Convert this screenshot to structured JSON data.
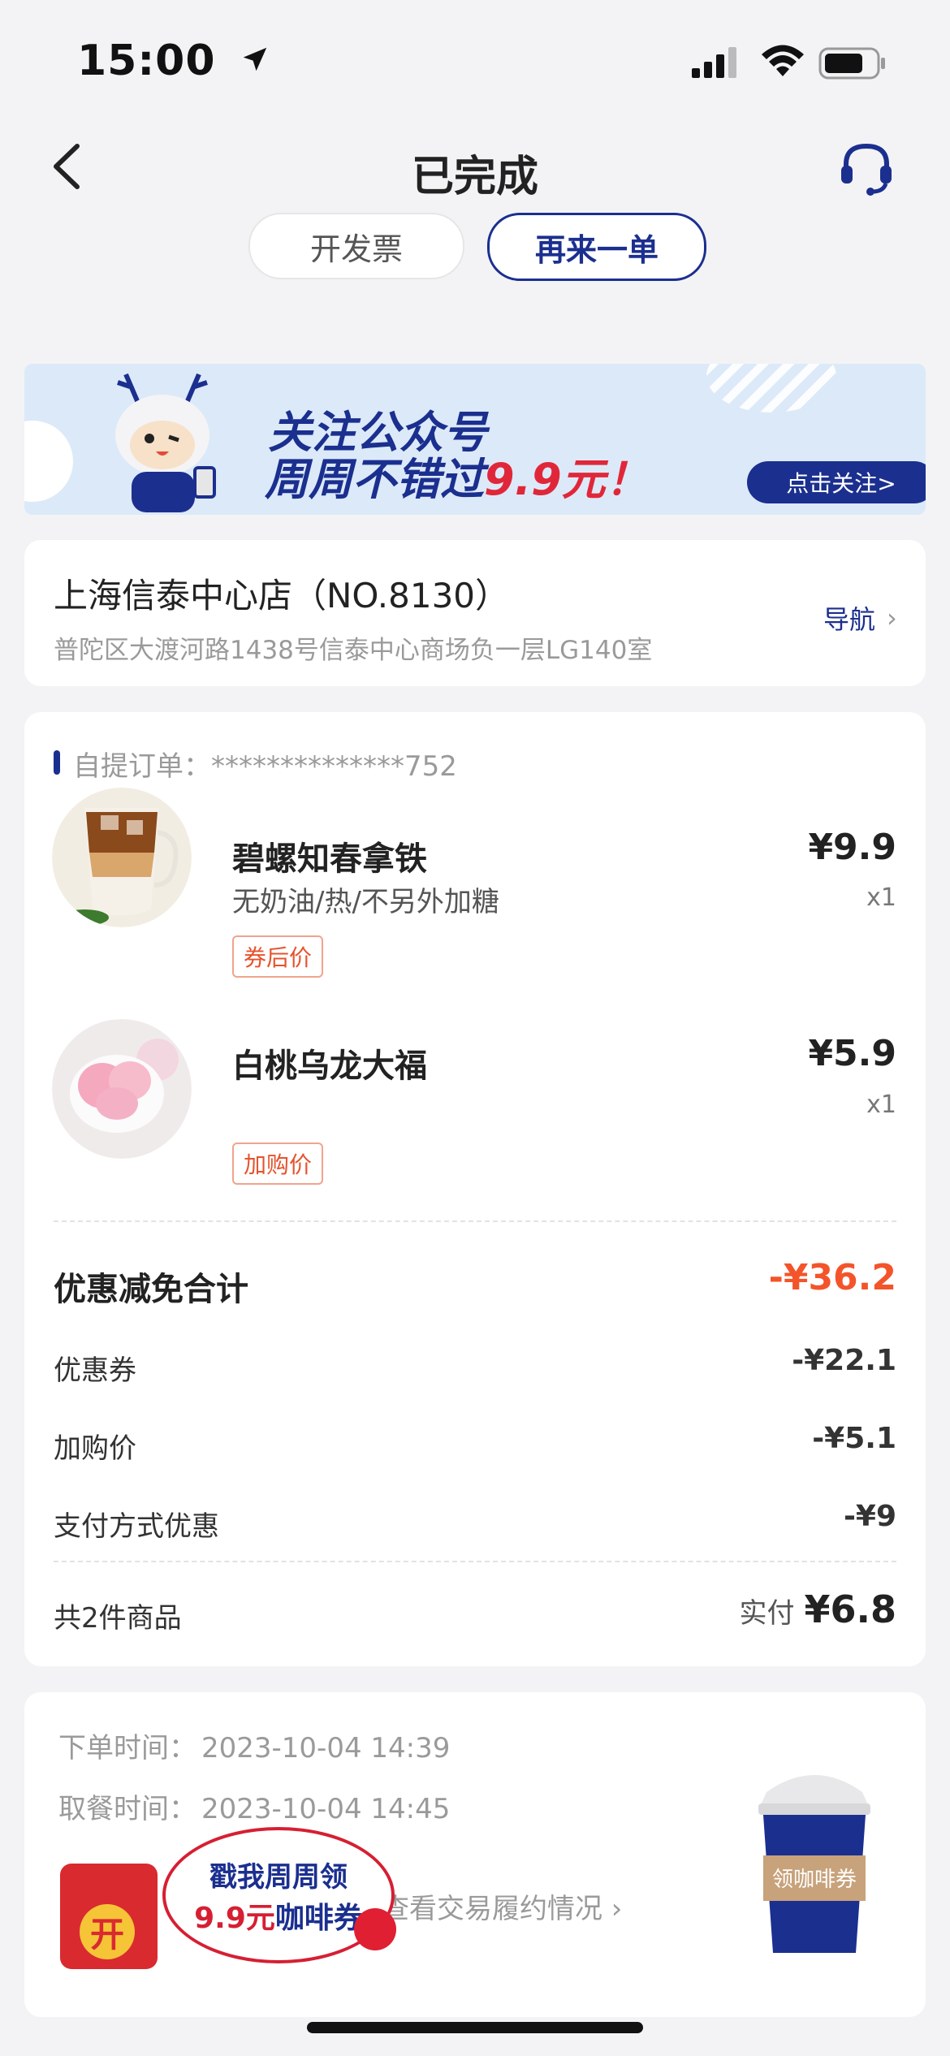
{
  "status_bar": {
    "time": "15:00"
  },
  "header": {
    "title": "已完成"
  },
  "actions": {
    "invoice": "开发票",
    "reorder": "再来一单"
  },
  "banner": {
    "line1": "关注公众号",
    "line2_prefix": "周周不错过",
    "line2_highlight": "9.9元！",
    "button": "点击关注>"
  },
  "store": {
    "name": "上海信泰中心店（NO.8130）",
    "address": "普陀区大渡河路1438号信泰中心商场负一层LG140室",
    "nav_label": "导航"
  },
  "order": {
    "label": "自提订单：",
    "number": "**************752",
    "items": [
      {
        "name": "碧螺知春拿铁",
        "spec": "无奶油/热/不另外加糖",
        "tag": "券后价",
        "price": "¥9.9",
        "qty": "x1"
      },
      {
        "name": "白桃乌龙大福",
        "spec": "",
        "tag": "加购价",
        "price": "¥5.9",
        "qty": "x1"
      }
    ],
    "discount_total_label": "优惠减免合计",
    "discount_total": "-¥36.2",
    "discounts": [
      {
        "label": "优惠券",
        "value": "-¥22.1"
      },
      {
        "label": "加购价",
        "value": "-¥5.1"
      },
      {
        "label": "支付方式优惠",
        "value": "-¥9"
      }
    ],
    "count_label": "共2件商品",
    "paid_label": "实付",
    "paid_value": "¥6.8"
  },
  "times": {
    "order_time_label": "下单时间：",
    "order_time": "2023-10-04 14:39",
    "pickup_time_label": "取餐时间：",
    "pickup_time": "2023-10-04 14:45",
    "trade_link": "查看交易履约情况"
  },
  "promo": {
    "line1": "戳我周周领",
    "line2_highlight": "9.9元",
    "line2_suffix": "咖啡券",
    "badge": "开",
    "cup_label": "领咖啡券"
  },
  "colors": {
    "brand": "#1b2f8f",
    "discount": "#f4542a",
    "promo_red": "#d61f33"
  }
}
